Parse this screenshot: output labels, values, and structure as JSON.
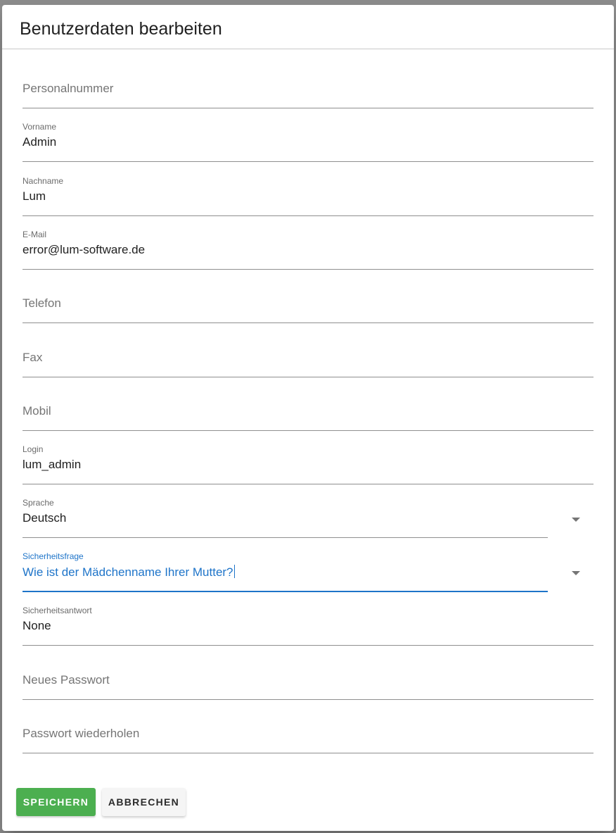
{
  "dialog": {
    "title": "Benutzerdaten bearbeiten"
  },
  "form": {
    "personalnummer": {
      "placeholder": "Personalnummer",
      "value": ""
    },
    "vorname": {
      "label": "Vorname",
      "value": "Admin"
    },
    "nachname": {
      "label": "Nachname",
      "value": "Lum"
    },
    "email": {
      "label": "E-Mail",
      "value": "error@lum-software.de"
    },
    "telefon": {
      "placeholder": "Telefon",
      "value": ""
    },
    "fax": {
      "placeholder": "Fax",
      "value": ""
    },
    "mobil": {
      "placeholder": "Mobil",
      "value": ""
    },
    "login": {
      "label": "Login",
      "value": "lum_admin"
    },
    "sprache": {
      "label": "Sprache",
      "value": "Deutsch",
      "icon": "arrow-drop-down-icon"
    },
    "sicherheitsfrage": {
      "label": "Sicherheitsfrage",
      "value": "Wie ist der Mädchenname Ihrer Mutter?",
      "icon": "arrow-drop-down-icon",
      "focused": true
    },
    "sicherheitsantwort": {
      "label": "Sicherheitsantwort",
      "value": "None"
    },
    "neues_passwort": {
      "placeholder": "Neues Passwort",
      "value": ""
    },
    "passwort_wiederholen": {
      "placeholder": "Passwort wiederholen",
      "value": ""
    }
  },
  "actions": {
    "save_label": "SPEICHERN",
    "cancel_label": "ABBRECHEN"
  },
  "colors": {
    "accent": "#1e74c9",
    "save_button": "#4caf50",
    "cancel_button": "#f5f5f5",
    "backdrop": "#8c8c8c"
  }
}
